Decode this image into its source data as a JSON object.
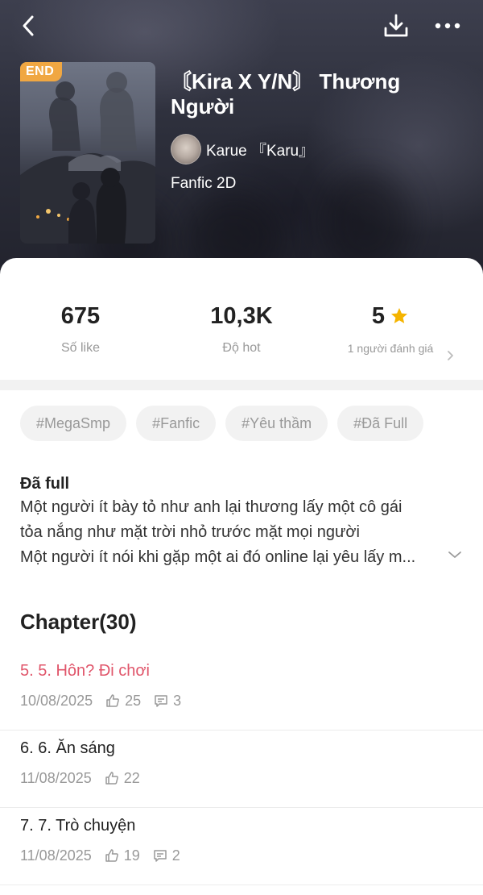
{
  "header": {
    "back_icon": "chevron-left-icon",
    "download_icon": "download-icon",
    "more_icon": "more-horizontal-icon"
  },
  "book": {
    "badge": "END",
    "title": "〘Kira X Y/N〙 Thương Người",
    "author": "Karue 『Karu』",
    "genre": "Fanfic 2D"
  },
  "stats": {
    "likes": {
      "value": "675",
      "label": "Số like"
    },
    "hot": {
      "value": "10,3K",
      "label": "Độ hot"
    },
    "rating": {
      "value": "5",
      "label": "1 người đánh giá"
    }
  },
  "tags": [
    "#MegaSmp",
    "#Fanfic",
    "#Yêu thầm",
    "#Đã Full"
  ],
  "description": {
    "heading": "Đã full",
    "lines": [
      "Một người ít bày tỏ như anh lại thương lấy một cô gái",
      "tỏa nắng như mặt trời nhỏ trước mặt mọi người",
      "Một người ít nói khi gặp một ai đó online lại yêu lấy m..."
    ]
  },
  "chapters_section": {
    "title": "Chapter(30)",
    "items": [
      {
        "name": "5. 5. Hôn? Đi chơi",
        "date": "10/08/2025",
        "likes": "25",
        "comments": "3"
      },
      {
        "name": "6. 6. Ăn sáng",
        "date": "11/08/2025",
        "likes": "22",
        "comments": ""
      },
      {
        "name": "7. 7. Trò chuyện",
        "date": "11/08/2025",
        "likes": "19",
        "comments": "2"
      }
    ]
  },
  "colors": {
    "badge": "#f0a742",
    "active_chapter": "#e0556a",
    "star": "#f5b400"
  }
}
